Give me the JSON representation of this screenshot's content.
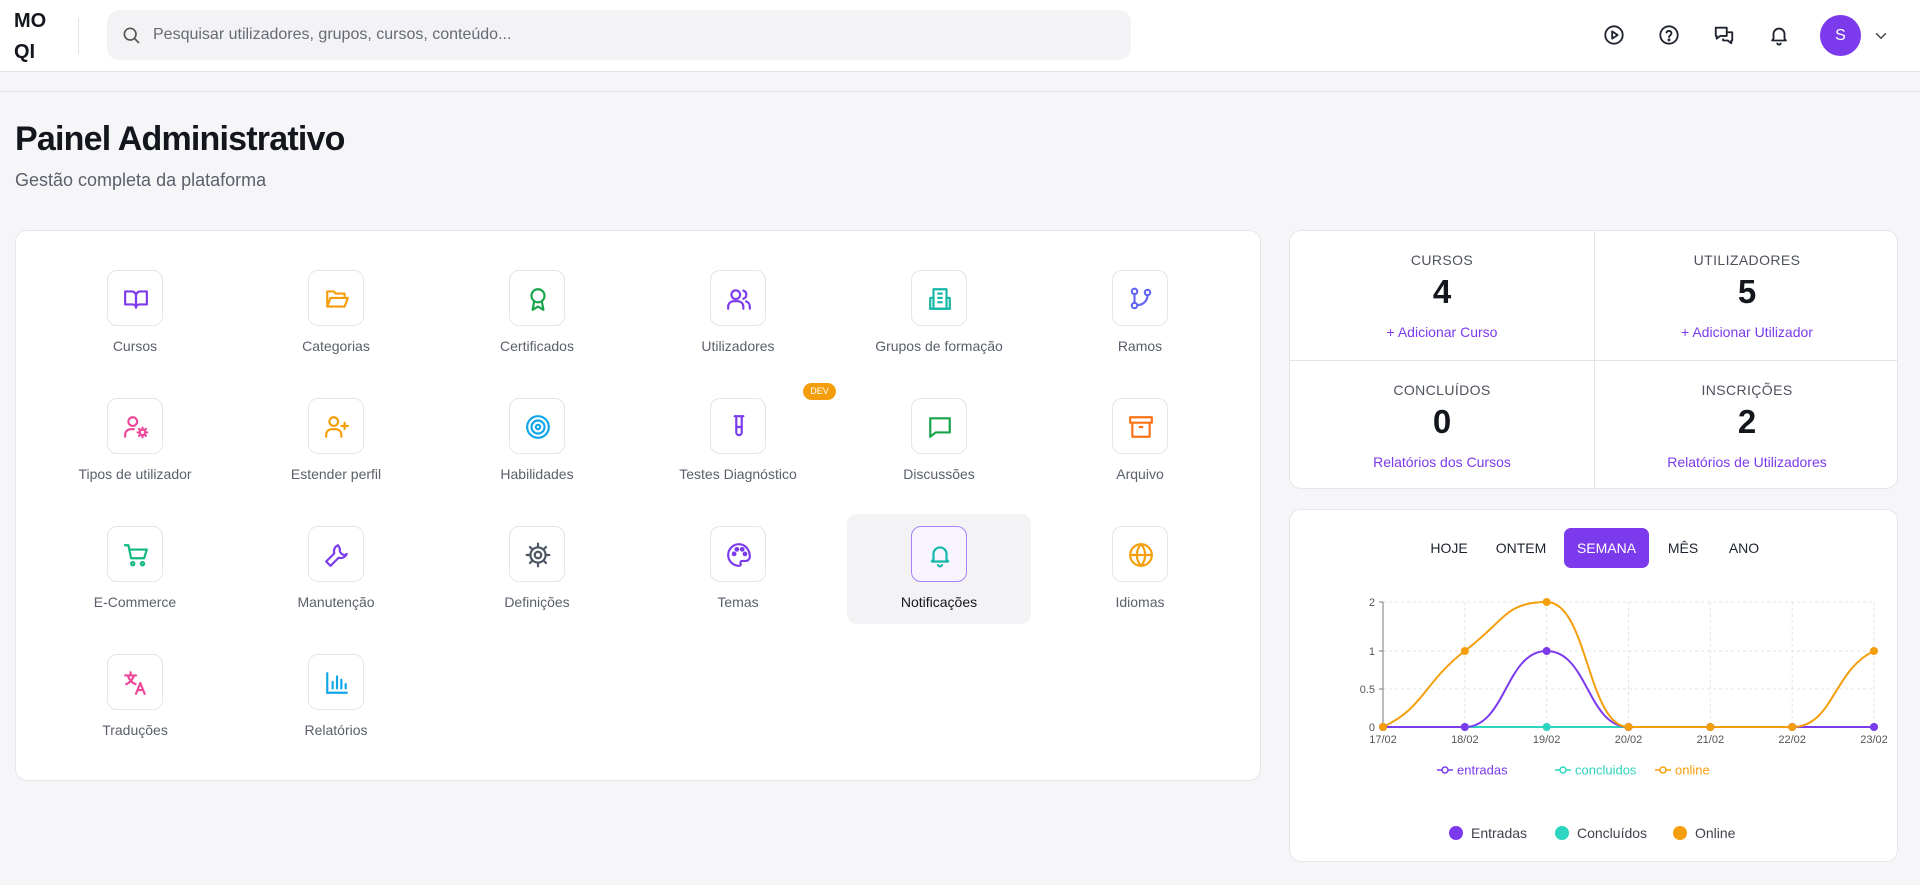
{
  "app": {
    "logo_line1": "MO",
    "logo_line2": "QI"
  },
  "header": {
    "search_placeholder": "Pesquisar utilizadores, grupos, cursos, conteúdo...",
    "icons": [
      "play-circle-icon",
      "help-circle-icon",
      "chat-bubbles-icon",
      "bell-icon"
    ],
    "avatar_initial": "S"
  },
  "page": {
    "title": "Painel Administrativo",
    "subtitle": "Gestão completa da plataforma"
  },
  "tiles": [
    {
      "label": "Cursos",
      "icon": "book-open-icon",
      "color": "#7c3aed"
    },
    {
      "label": "Categorias",
      "icon": "folder-open-icon",
      "color": "#f59e0b"
    },
    {
      "label": "Certificados",
      "icon": "award-icon",
      "color": "#16a34a"
    },
    {
      "label": "Utilizadores",
      "icon": "users-icon",
      "color": "#7c3aed"
    },
    {
      "label": "Grupos de formação",
      "icon": "building-icon",
      "color": "#14b8a6"
    },
    {
      "label": "Ramos",
      "icon": "git-branch-icon",
      "color": "#6366f1"
    },
    {
      "label": "Tipos de utilizador",
      "icon": "user-cog-icon",
      "color": "#ec4899"
    },
    {
      "label": "Estender perfil",
      "icon": "user-plus-icon",
      "color": "#f59e0b"
    },
    {
      "label": "Habilidades",
      "icon": "target-icon",
      "color": "#0ea5e9"
    },
    {
      "label": "Testes Diagnóstico",
      "icon": "test-tube-icon",
      "color": "#7c3aed"
    },
    {
      "label": "Discussões",
      "icon": "message-square-icon",
      "color": "#16a34a"
    },
    {
      "label": "Arquivo",
      "icon": "archive-icon",
      "color": "#f97316"
    },
    {
      "label": "E-Commerce",
      "icon": "shopping-cart-icon",
      "color": "#10b981"
    },
    {
      "label": "Manutenção",
      "icon": "wrench-icon",
      "color": "#7c3aed"
    },
    {
      "label": "Definições",
      "icon": "gear-icon",
      "color": "#4b5563"
    },
    {
      "label": "Temas",
      "icon": "palette-icon",
      "color": "#7c3aed"
    },
    {
      "label": "Notificações",
      "icon": "bell-icon",
      "color": "#14b8a6"
    },
    {
      "label": "Idiomas",
      "icon": "globe-icon",
      "color": "#f59e0b"
    },
    {
      "label": "Traduções",
      "icon": "languages-icon",
      "color": "#ec4899"
    },
    {
      "label": "Relatórios",
      "icon": "bar-chart-icon",
      "color": "#0ea5e9"
    }
  ],
  "dev_badge": "DEV",
  "stats": [
    {
      "label": "CURSOS",
      "value": "4",
      "link": "+ Adicionar Curso"
    },
    {
      "label": "UTILIZADORES",
      "value": "5",
      "link": "+ Adicionar Utilizador"
    },
    {
      "label": "CONCLUÍDOS",
      "value": "0",
      "link": "Relatórios dos Cursos"
    },
    {
      "label": "INSCRIÇÕES",
      "value": "2",
      "link": "Relatórios de Utilizadores"
    }
  ],
  "period_tabs": [
    {
      "label": "HOJE",
      "active": false
    },
    {
      "label": "ONTEM",
      "active": false
    },
    {
      "label": "SEMANA",
      "active": true
    },
    {
      "label": "MÊS",
      "active": false
    },
    {
      "label": "ANO",
      "active": false
    }
  ],
  "chart_data": {
    "type": "line",
    "categories": [
      "17/02",
      "18/02",
      "19/02",
      "20/02",
      "21/02",
      "22/02",
      "23/02"
    ],
    "series": [
      {
        "name": "entradas",
        "values": [
          0,
          0,
          1,
          0,
          0,
          0,
          0
        ],
        "color": "#7c3aed"
      },
      {
        "name": "concluidos",
        "values": [
          0,
          0,
          0,
          0,
          0,
          0,
          0
        ],
        "color": "#2dd4bf"
      },
      {
        "name": "online",
        "values": [
          0,
          1,
          2,
          0,
          0,
          0,
          1
        ],
        "color": "#f59e0b"
      }
    ],
    "yticks": [
      "0",
      "0.5",
      "1",
      "2"
    ],
    "ylim": [
      0,
      2
    ],
    "grid": true,
    "legend_position": "bottom",
    "bottom_legend": [
      {
        "label": "Entradas",
        "color": "#7c3aed"
      },
      {
        "label": "Concluídos",
        "color": "#2dd4bf"
      },
      {
        "label": "Online",
        "color": "#f59e0b"
      }
    ]
  }
}
